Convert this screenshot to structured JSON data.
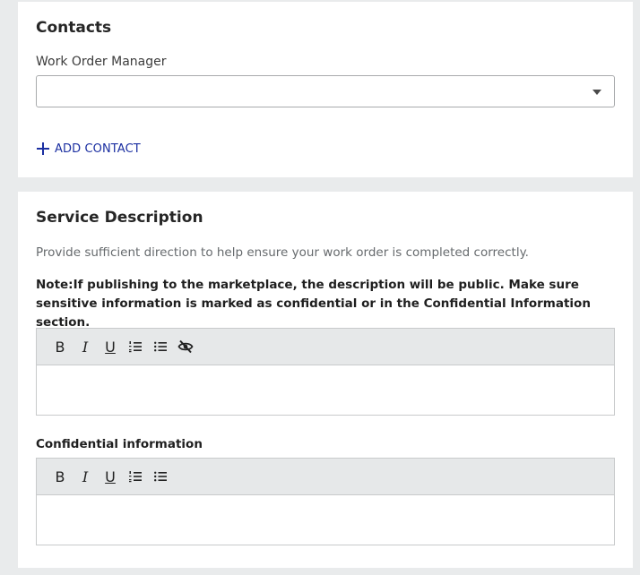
{
  "contacts": {
    "title": "Contacts",
    "work_order_manager_label": "Work Order Manager",
    "work_order_manager_value": "",
    "add_contact_label": "ADD CONTACT"
  },
  "service": {
    "title": "Service Description",
    "help_text": "Provide sufficient direction to help ensure your work order is completed correctly.",
    "note": "Note:If publishing to the marketplace, the description will be public. Make sure sensitive information is marked as confidential or in the Confidential Information section.",
    "description_value": "",
    "toolbar": {
      "bold": "B",
      "italic": "I",
      "underline": "U"
    },
    "confidential_label": "Confidential information",
    "confidential_value": ""
  },
  "colors": {
    "link": "#1b2fa1",
    "page_bg": "#e9ebec",
    "toolbar_bg": "#e6e8e9"
  },
  "icons": [
    "plus-icon",
    "chevron-down-icon",
    "ordered-list-icon",
    "bullet-list-icon",
    "eye-off-icon"
  ]
}
